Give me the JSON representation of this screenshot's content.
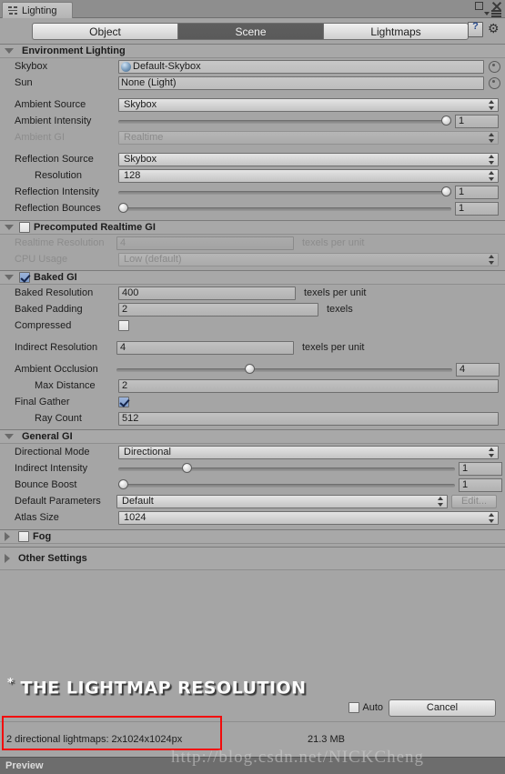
{
  "window": {
    "tab_label": "Lighting",
    "tab_icon": "lighting-icon",
    "minimize_icon": "minimize-icon",
    "close_icon": "close-icon",
    "menu_icon": "hamburger-menu-icon"
  },
  "toolbar": {
    "tabs": [
      {
        "label": "Object",
        "active": false
      },
      {
        "label": "Scene",
        "active": true
      },
      {
        "label": "Lightmaps",
        "active": false
      }
    ],
    "help_icon": "help-icon",
    "gear_icon": "gear-icon"
  },
  "sections": {
    "environment": {
      "title": "Environment Lighting",
      "skybox_label": "Skybox",
      "skybox_value": "Default-Skybox",
      "sun_label": "Sun",
      "sun_value": "None (Light)",
      "ambient_source_label": "Ambient Source",
      "ambient_source_value": "Skybox",
      "ambient_intensity_label": "Ambient Intensity",
      "ambient_intensity_value": "1",
      "ambient_gi_label": "Ambient GI",
      "ambient_gi_value": "Realtime",
      "reflection_source_label": "Reflection Source",
      "reflection_source_value": "Skybox",
      "resolution_label": "Resolution",
      "resolution_value": "128",
      "reflection_intensity_label": "Reflection Intensity",
      "reflection_intensity_value": "1",
      "reflection_bounces_label": "Reflection Bounces",
      "reflection_bounces_value": "1"
    },
    "precomputed": {
      "title": "Precomputed Realtime GI",
      "realtime_resolution_label": "Realtime Resolution",
      "realtime_resolution_value": "4",
      "realtime_resolution_unit": "texels per unit",
      "cpu_usage_label": "CPU Usage",
      "cpu_usage_value": "Low (default)"
    },
    "baked": {
      "title": "Baked GI",
      "baked_resolution_label": "Baked Resolution",
      "baked_resolution_value": "400",
      "baked_resolution_unit": "texels per unit",
      "baked_padding_label": "Baked Padding",
      "baked_padding_value": "2",
      "baked_padding_unit": "texels",
      "compressed_label": "Compressed",
      "indirect_resolution_label": "Indirect Resolution",
      "indirect_resolution_value": "4",
      "indirect_resolution_unit": "texels per unit",
      "ambient_occlusion_label": "Ambient Occlusion",
      "ambient_occlusion_value": "4",
      "max_distance_label": "Max Distance",
      "max_distance_value": "2",
      "final_gather_label": "Final Gather",
      "ray_count_label": "Ray Count",
      "ray_count_value": "512"
    },
    "general": {
      "title": "General GI",
      "directional_mode_label": "Directional Mode",
      "directional_mode_value": "Directional",
      "indirect_intensity_label": "Indirect Intensity",
      "indirect_intensity_value": "1",
      "bounce_boost_label": "Bounce Boost",
      "bounce_boost_value": "1",
      "default_parameters_label": "Default Parameters",
      "default_parameters_value": "Default",
      "edit_button_label": "Edit...",
      "atlas_size_label": "Atlas Size",
      "atlas_size_value": "1024"
    },
    "fog": {
      "title": "Fog"
    },
    "other": {
      "title": "Other Settings"
    }
  },
  "bottom": {
    "auto_label": "Auto",
    "cancel_label": "Cancel",
    "lightmap_stats": "2 directional lightmaps: 2x1024x1024px",
    "memory_size": "21.3 MB",
    "preview_label": "Preview"
  },
  "annotations": {
    "headline": "THE LIGHTMAP RESOLUTION",
    "headline_star": "*",
    "watermark": "http://blog.csdn.net/NICKCheng"
  },
  "colors": {
    "panel_bg": "#a5a5a5",
    "accent_checkbox": "#7e9ccb",
    "annotation_red": "#f20b0b",
    "status_bar": "#6d6d6d"
  }
}
